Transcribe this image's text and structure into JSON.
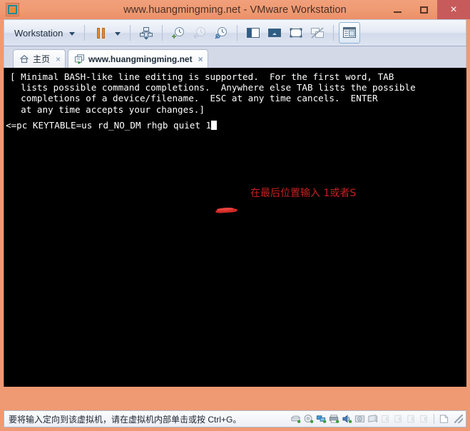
{
  "window": {
    "title": "www.huangmingming.net - VMware Workstation",
    "app_icon": "vmware-logo-icon",
    "buttons": {
      "minimize": "minimize-icon",
      "maximize": "maximize-icon",
      "close": "×"
    }
  },
  "toolbar": {
    "menu_label": "Workstation",
    "items": [
      {
        "name": "workstation-menu",
        "label": "Workstation",
        "icon": "chevron-down-icon"
      },
      {
        "name": "suspend-button",
        "label": "",
        "icon": "pause-icon"
      },
      {
        "name": "power-dropdown",
        "label": "",
        "icon": "chevron-down-icon"
      },
      {
        "name": "manage-snapshot-button",
        "label": "",
        "icon": "snapshot-manager-icon"
      },
      {
        "name": "take-snapshot-button",
        "label": "",
        "icon": "clock-plus-icon"
      },
      {
        "name": "revert-snapshot-button",
        "label": "",
        "icon": "clock-revert-icon"
      },
      {
        "name": "snapshot-manager-button",
        "label": "",
        "icon": "clock-wrench-icon"
      },
      {
        "name": "show-library-button",
        "label": "",
        "icon": "sidebar-panel-icon"
      },
      {
        "name": "show-console-view-button",
        "label": "",
        "icon": "console-view-icon"
      },
      {
        "name": "enter-fullscreen-button",
        "label": "",
        "icon": "fullscreen-icon"
      },
      {
        "name": "multiple-monitors-button",
        "label": "",
        "icon": "multi-monitor-disabled-icon"
      },
      {
        "name": "show-thumbnail-bar-button",
        "label": "",
        "icon": "thumbnail-panel-icon"
      }
    ]
  },
  "tabs": [
    {
      "label": "主页",
      "icon": "home-icon",
      "close": "×",
      "active": false
    },
    {
      "label": "www.huangmingming.net",
      "icon": "vm-icon",
      "close": "×",
      "active": true
    }
  ],
  "vm_screen": {
    "background_color": "#000000",
    "text_color": "#ffffff",
    "help_text": "[ Minimal BASH-like line editing is supported.  For the first word, TAB\n  lists possible command completions.  Anywhere else TAB lists the possible\n  completions of a device/filename.  ESC at any time cancels.  ENTER\n  at any time accepts your changes.]",
    "command_line": "<=pc KEYTABLE=us rd_NO_DM rhgb quiet 1",
    "cursor": "block-cursor",
    "annotation": {
      "text": "在最后位置输入 1或者S",
      "color": "#c4221f",
      "underline_color": "#cf2b27"
    }
  },
  "statusbar": {
    "message": "要将输入定向到该虚拟机，请在虚拟机内部单击或按 Ctrl+G。",
    "device_icons": [
      "hard-disk-icon",
      "cd-dvd-icon",
      "network-adapter-icon",
      "printer-icon",
      "sound-card-icon",
      "camera-icon",
      "display-icon",
      "usb-device-1-icon",
      "usb-device-2-icon",
      "usb-device-3-icon",
      "usb-device-4-icon",
      "message-log-icon",
      "resize-grip-icon"
    ]
  },
  "colors": {
    "titlebar": "#ef9a72",
    "close_button": "#c75b5b",
    "tabstrip": "#d4d9e8",
    "toolbar": "#e3e9f4"
  }
}
